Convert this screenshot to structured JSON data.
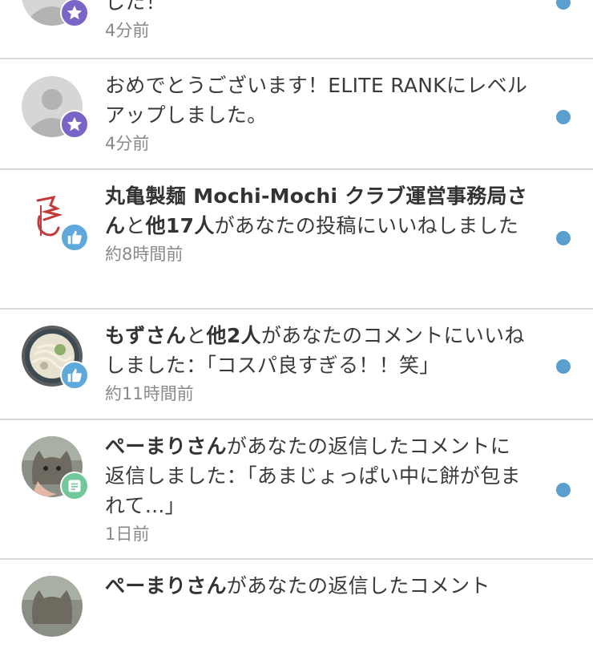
{
  "colors": {
    "unread_dot": "#5a9fcd",
    "star_badge": "#7b64c8",
    "like_badge": "#5fa9da",
    "reply_badge": "#72c79c",
    "divider": "#d9d9d9",
    "time_text": "#8a8a8a"
  },
  "notifications": [
    {
      "avatar": "default-user-avatar",
      "badge": "star-icon",
      "parts": [
        {
          "text": "した！",
          "bold": false
        }
      ],
      "time": "4分前",
      "unread": true
    },
    {
      "avatar": "default-user-avatar",
      "badge": "star-icon",
      "parts": [
        {
          "text": "おめでとうございます！ELITE RANKにレベルアップしました。",
          "bold": false
        }
      ],
      "time": "4分前",
      "unread": true
    },
    {
      "avatar": "brand-logo-avatar",
      "badge": "thumbs-up-icon",
      "parts": [
        {
          "text": "丸亀製麺 Mochi-Mochi クラブ運営事務局さん",
          "bold": true
        },
        {
          "text": "と",
          "bold": false
        },
        {
          "text": "他17人",
          "bold": true
        },
        {
          "text": "があなたの投稿にいいねしました",
          "bold": false
        }
      ],
      "time": "約8時間前",
      "unread": true
    },
    {
      "avatar": "noodle-photo-avatar",
      "badge": "thumbs-up-icon",
      "parts": [
        {
          "text": "もずさん",
          "bold": true
        },
        {
          "text": "と",
          "bold": false
        },
        {
          "text": "他2人",
          "bold": true
        },
        {
          "text": "があなたのコメントにいいねしました：「コスパ良すぎる！！笑」",
          "bold": false
        }
      ],
      "time": "約11時間前",
      "unread": true
    },
    {
      "avatar": "cat-photo-avatar",
      "badge": "comment-icon",
      "parts": [
        {
          "text": "ぺーまりさん",
          "bold": true
        },
        {
          "text": "があなたの返信したコメントに返信しました：「あまじょっぱい中に餅が包まれて...」",
          "bold": false
        }
      ],
      "time": "1日前",
      "unread": true
    },
    {
      "avatar": "cat-photo-avatar",
      "badge": "comment-icon",
      "parts": [
        {
          "text": "ぺーまりさん",
          "bold": true
        },
        {
          "text": "があなたの返信したコメント",
          "bold": false
        }
      ],
      "time": "",
      "unread": true
    }
  ]
}
